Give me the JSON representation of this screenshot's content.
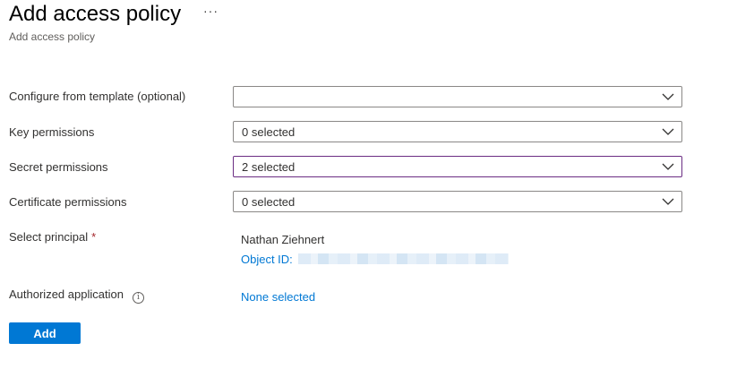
{
  "page": {
    "title": "Add access policy",
    "more_icon": "ellipsis-icon",
    "more_label": "···",
    "subtitle": "Add access policy"
  },
  "form": {
    "template": {
      "label": "Configure from template (optional)",
      "value": ""
    },
    "key_permissions": {
      "label": "Key permissions",
      "value": "0 selected"
    },
    "secret_permissions": {
      "label": "Secret permissions",
      "value": "2 selected"
    },
    "certificate_permissions": {
      "label": "Certificate permissions",
      "value": "0 selected"
    },
    "principal": {
      "label": "Select principal",
      "required_marker": "*",
      "name": "Nathan Ziehnert",
      "object_id_label": "Object ID:"
    },
    "authorized_application": {
      "label": "Authorized application",
      "info_glyph": "i",
      "value": "None selected"
    }
  },
  "actions": {
    "add_label": "Add"
  },
  "colors": {
    "accent": "#0078d4",
    "focus_border": "#6b2d83",
    "required": "#a4262c",
    "border": "#8a8886"
  }
}
